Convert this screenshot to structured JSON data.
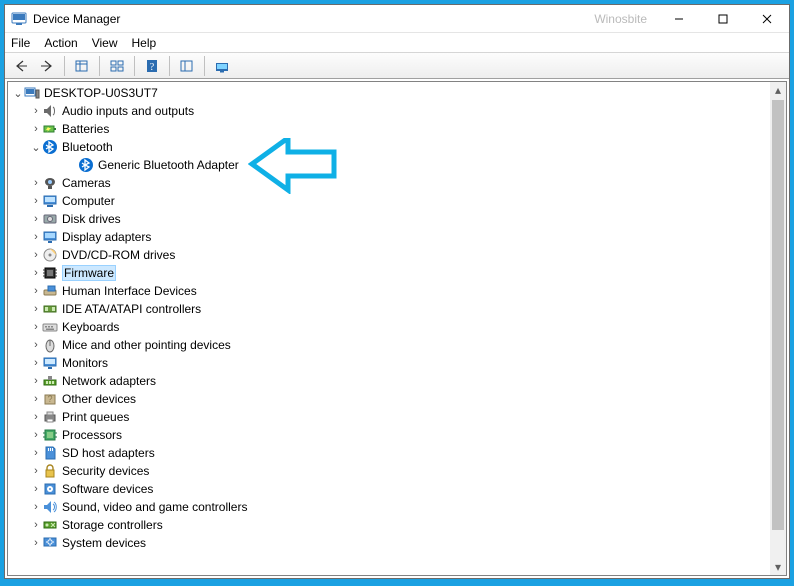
{
  "window": {
    "title": "Device Manager",
    "watermark": "Winosbite"
  },
  "menu": {
    "file": "File",
    "action": "Action",
    "view": "View",
    "help": "Help"
  },
  "root": {
    "label": "DESKTOP-U0S3UT7"
  },
  "categories": [
    {
      "icon": "audio",
      "label": "Audio inputs and outputs",
      "expanded": false
    },
    {
      "icon": "battery",
      "label": "Batteries",
      "expanded": false
    },
    {
      "icon": "bluetooth",
      "label": "Bluetooth",
      "expanded": true,
      "children": [
        {
          "icon": "bluetooth",
          "label": "Generic Bluetooth Adapter"
        }
      ]
    },
    {
      "icon": "camera",
      "label": "Cameras",
      "expanded": false
    },
    {
      "icon": "computer",
      "label": "Computer",
      "expanded": false
    },
    {
      "icon": "disk",
      "label": "Disk drives",
      "expanded": false
    },
    {
      "icon": "display",
      "label": "Display adapters",
      "expanded": false
    },
    {
      "icon": "optical",
      "label": "DVD/CD-ROM drives",
      "expanded": false
    },
    {
      "icon": "firmware",
      "label": "Firmware",
      "expanded": false,
      "selected": true
    },
    {
      "icon": "hid",
      "label": "Human Interface Devices",
      "expanded": false
    },
    {
      "icon": "ide",
      "label": "IDE ATA/ATAPI controllers",
      "expanded": false
    },
    {
      "icon": "keyboard",
      "label": "Keyboards",
      "expanded": false
    },
    {
      "icon": "mouse",
      "label": "Mice and other pointing devices",
      "expanded": false
    },
    {
      "icon": "monitor",
      "label": "Monitors",
      "expanded": false
    },
    {
      "icon": "network",
      "label": "Network adapters",
      "expanded": false
    },
    {
      "icon": "other",
      "label": "Other devices",
      "expanded": false
    },
    {
      "icon": "printer",
      "label": "Print queues",
      "expanded": false
    },
    {
      "icon": "cpu",
      "label": "Processors",
      "expanded": false
    },
    {
      "icon": "sd",
      "label": "SD host adapters",
      "expanded": false
    },
    {
      "icon": "security",
      "label": "Security devices",
      "expanded": false
    },
    {
      "icon": "software",
      "label": "Software devices",
      "expanded": false
    },
    {
      "icon": "sound",
      "label": "Sound, video and game controllers",
      "expanded": false
    },
    {
      "icon": "storage",
      "label": "Storage controllers",
      "expanded": false
    },
    {
      "icon": "system",
      "label": "System devices",
      "expanded": false
    }
  ]
}
